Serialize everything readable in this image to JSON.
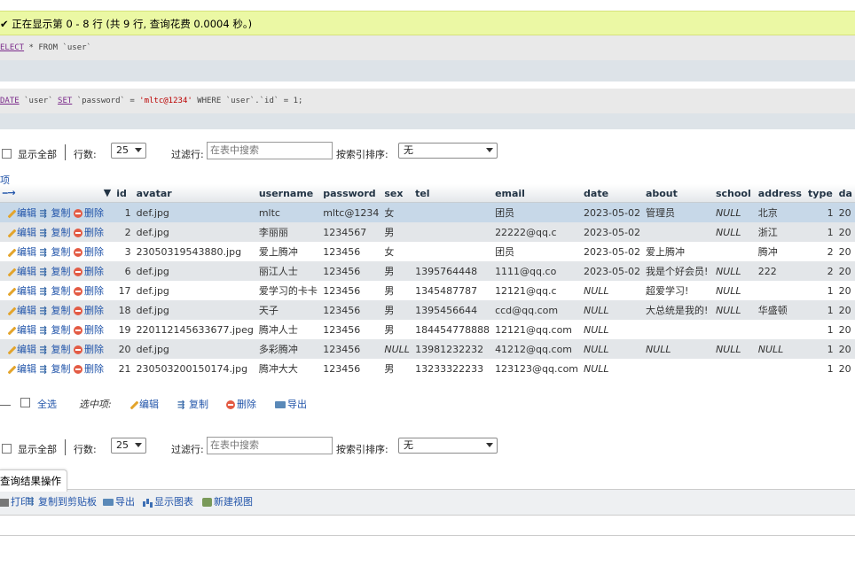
{
  "notice": "✔ 正在显示第 0 - 8 行 (共 9 行, 查询花费 0.0004 秒。)",
  "sql1": {
    "kw": "ELECT",
    "rest": " * FROM `user`"
  },
  "sql2": {
    "kw1": "DATE",
    "p1": " `user` ",
    "kw2": "SET",
    "p2": " `password` = ",
    "str": "'mltc@1234'",
    "p3": " WHERE `user`.`id` = 1;"
  },
  "controls": {
    "show_all": "显示全部",
    "rows_label": "行数:",
    "rows_value": "25",
    "filter_label": "过滤行:",
    "filter_placeholder": "在表中搜索",
    "sort_label": "按索引排序:",
    "sort_value": "无"
  },
  "options_label": "项",
  "columns": [
    "id",
    "avatar",
    "username",
    "password",
    "sex",
    "tel",
    "email",
    "date",
    "about",
    "school",
    "address",
    "type",
    "da"
  ],
  "row_actions": {
    "edit": "编辑",
    "copy": "复制",
    "delete": "删除"
  },
  "rows": [
    [
      "1",
      "def.jpg",
      "mltc",
      "mltc@1234",
      "女",
      "",
      "团员",
      "2023-05-02",
      "管理员",
      "NULL",
      "北京",
      "1",
      "20"
    ],
    [
      "2",
      "def.jpg",
      "李丽丽",
      "1234567",
      "男",
      "",
      "22222@qq.c",
      "2023-05-02",
      "",
      "NULL",
      "浙江",
      "1",
      "20"
    ],
    [
      "3",
      "23050319543880.jpg",
      "爱上腾冲",
      "123456",
      "女",
      "",
      "团员",
      "2023-05-02",
      "爱上腾冲",
      "",
      "腾冲",
      "2",
      "20"
    ],
    [
      "6",
      "def.jpg",
      "丽江人士",
      "123456",
      "男",
      "1395764448",
      "1111@qq.co",
      "2023-05-02",
      "我是个好会员!",
      "NULL",
      "222",
      "2",
      "20"
    ],
    [
      "17",
      "def.jpg",
      "爱学习的卡卡",
      "123456",
      "男",
      "1345487787",
      "12121@qq.c",
      "NULL",
      "超爱学习!",
      "NULL",
      "",
      "1",
      "20"
    ],
    [
      "18",
      "def.jpg",
      "天子",
      "123456",
      "男",
      "1395456644",
      "ccd@qq.com",
      "NULL",
      "大总统是我的!",
      "NULL",
      "华盛顿",
      "1",
      "20"
    ],
    [
      "19",
      "220112145633677.jpeg",
      "腾冲人士",
      "123456",
      "男",
      "184454778888",
      "12121@qq.com",
      "NULL",
      "",
      "",
      "",
      "1",
      "20"
    ],
    [
      "20",
      "def.jpg",
      "多彩腾冲",
      "123456",
      "NULL",
      "13981232232",
      "41212@qq.com",
      "NULL",
      "NULL",
      "NULL",
      "NULL",
      "1",
      "20"
    ],
    [
      "21",
      "230503200150174.jpg",
      "腾冲大大",
      "123456",
      "男",
      "13233322233",
      "123123@qq.com",
      "NULL",
      "",
      "",
      "",
      "1",
      "20"
    ]
  ],
  "bulk": {
    "select_all": "全选",
    "with_selected": "选中项:",
    "edit": "编辑",
    "copy": "复制",
    "delete": "删除",
    "export": "导出"
  },
  "query_ops": {
    "title": "查询结果操作",
    "print": "打印",
    "copy_clipboard": "复制到剪贴板",
    "export": "导出",
    "show_chart": "显示图表",
    "create_view": "新建视图"
  }
}
